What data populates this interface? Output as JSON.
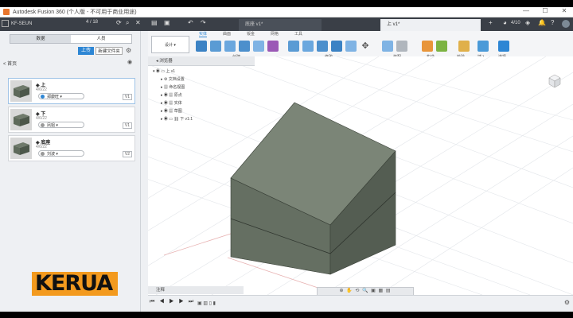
{
  "window": {
    "title": "Autodesk Fusion 360 (个人版 - 不可用于商业用途)",
    "minimize": "—",
    "maximize": "☐",
    "close": "✕"
  },
  "appbar": {
    "team": "KF-SEUN",
    "pager": "4 / 18",
    "tabs": [
      {
        "label": "底座 v1*",
        "active": false
      },
      {
        "label": "上 v1*",
        "active": true
      }
    ],
    "count": "4/10"
  },
  "data_panel": {
    "segments": [
      "数据",
      "人员"
    ],
    "upload": "上传",
    "new_project": "新建文件夹",
    "breadcrumb": "< 首页",
    "items": [
      {
        "name": "上",
        "sub": "4/6/22",
        "dropdown": "郑康旺",
        "version": "V1"
      },
      {
        "name": "下",
        "sub": "4/6/22",
        "dropdown": "凤姐",
        "version": "V1"
      },
      {
        "name": "底座",
        "sub": "4/6/22",
        "dropdown": "刘波",
        "version": "V2"
      }
    ]
  },
  "logo": "KERUA",
  "toolbar": {
    "workspace": "设计",
    "tabs": [
      "实体",
      "曲面",
      "钣金",
      "网格",
      "工具"
    ],
    "groups": [
      "创建",
      "修改",
      "装配",
      "构造",
      "检验",
      "插入",
      "选择"
    ]
  },
  "browser": {
    "title": "浏览器",
    "items": [
      "上 v1",
      "文档设置",
      "命名视图",
      "原点",
      "实体",
      "草图",
      "下 v1:1"
    ]
  },
  "comments": "注释",
  "navbar_icons": "⊕ ✋ ⟲ 🔍 ▣ ▦ ▤",
  "timeline": {
    "controls": "⏮ ◀ ▶ ▶ ⏭"
  },
  "colors": {
    "accent": "#2d86d4",
    "logo_bg": "#f39a1e",
    "cube_top": "#6f7a6b",
    "cube_front": "#5e6a5b",
    "cube_side": "#4c574a"
  }
}
